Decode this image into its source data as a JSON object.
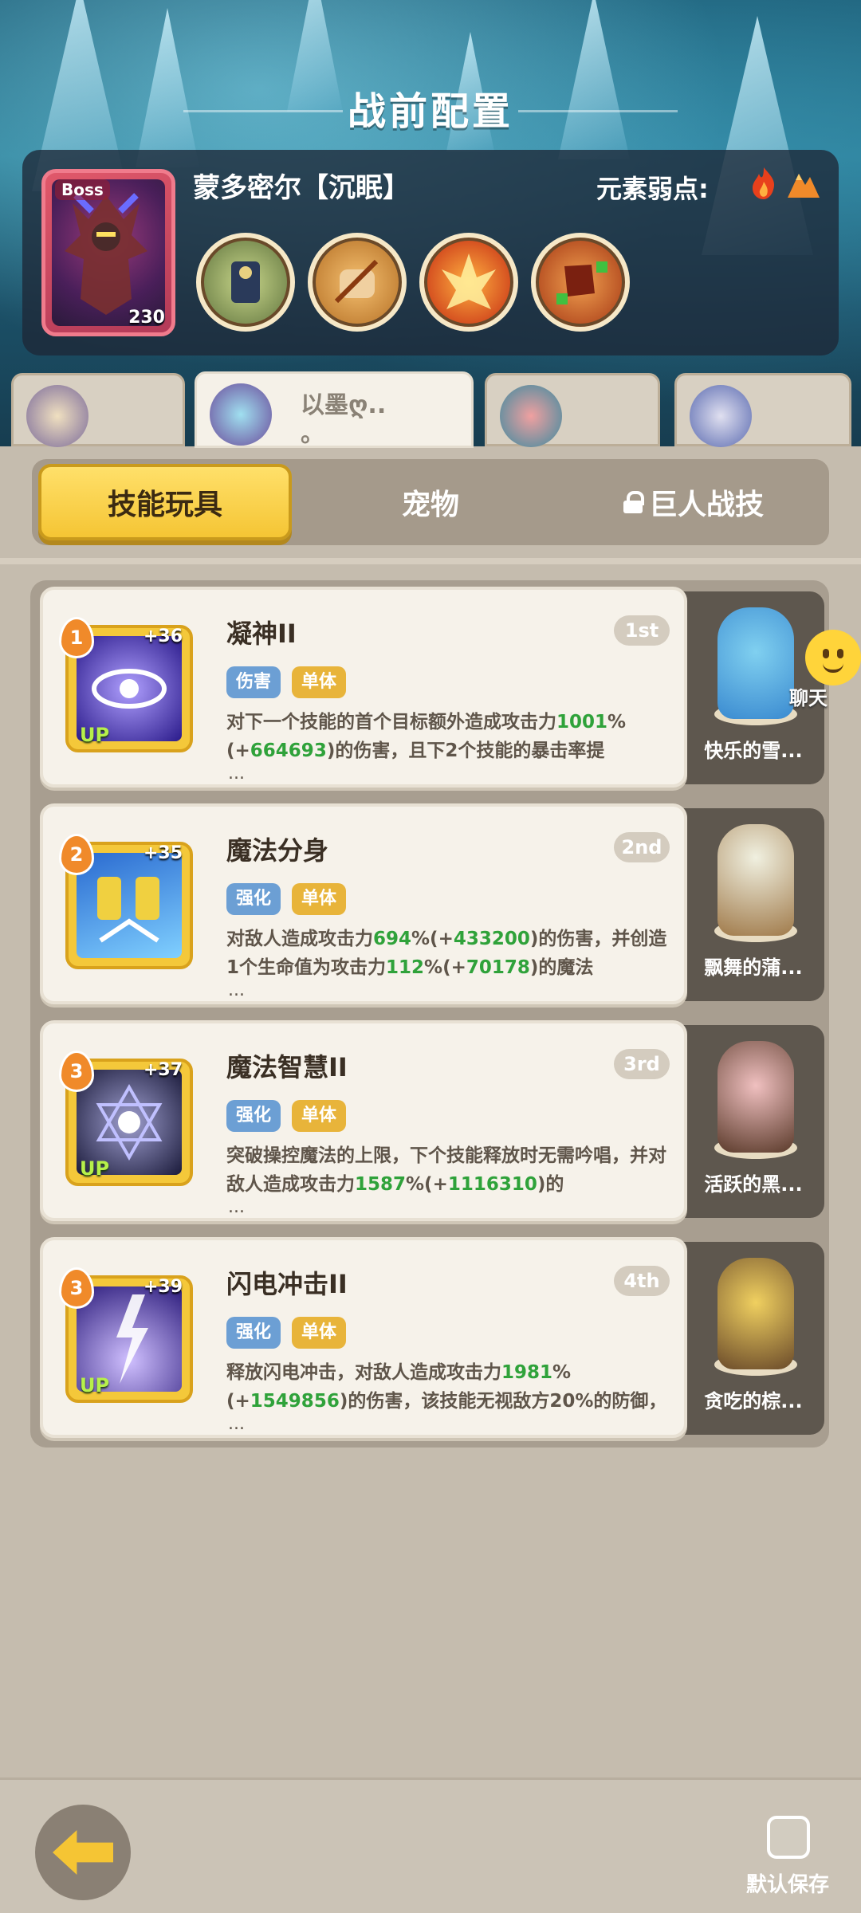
{
  "header": {
    "title": "战前配置"
  },
  "boss": {
    "tag": "Boss",
    "level": "230",
    "name": "蒙多密尔【沉眠】",
    "weakness_label": "元素弱点:",
    "weakness_icons": [
      "fire-element-icon",
      "earth-element-icon"
    ],
    "skill_icons": [
      "boss-skill-1-icon",
      "boss-skill-2-icon",
      "boss-skill-3-icon",
      "boss-skill-4-icon"
    ]
  },
  "heroes": [
    {
      "name": "",
      "active": false
    },
    {
      "name": "以墨ღ..",
      "sub": "。",
      "active": true
    },
    {
      "name": "",
      "active": false
    },
    {
      "name": "",
      "active": false
    }
  ],
  "tabs": [
    {
      "label": "技能玩具",
      "active": true
    },
    {
      "label": "宠物",
      "active": false
    },
    {
      "label": "巨人战技",
      "active": false,
      "locked": true
    }
  ],
  "skills": [
    {
      "rank": "1",
      "level_plus": "+36",
      "up": "UP",
      "name": "凝神II",
      "order": "1st",
      "tags": [
        "伤害",
        "单体"
      ],
      "desc_a": "对下一个技能的首个目标额外造成攻击力",
      "desc_b": "1001",
      "desc_c": "%(+",
      "desc_d": "664693",
      "desc_e": ")的伤害，且下2个技能的暴击率提",
      "more": "...",
      "pet": "快乐的雪..."
    },
    {
      "rank": "2",
      "level_plus": "+35",
      "up": "",
      "name": "魔法分身",
      "order": "2nd",
      "tags": [
        "强化",
        "单体"
      ],
      "desc_a": "对敌人造成攻击力",
      "desc_b": "694",
      "desc_c": "%(+",
      "desc_d": "433200",
      "desc_e": ")的伤害，并创造1个生命值为攻击力",
      "desc_f": "112",
      "desc_g": "%(+",
      "desc_h": "70178",
      "desc_i": ")的魔法",
      "more": "...",
      "pet": "飘舞的蒲..."
    },
    {
      "rank": "3",
      "level_plus": "+37",
      "up": "UP",
      "name": "魔法智慧II",
      "order": "3rd",
      "tags": [
        "强化",
        "单体"
      ],
      "desc_a": "突破操控魔法的上限，下个技能释放时无需吟唱，并对敌人造成攻击力",
      "desc_b": "1587",
      "desc_c": "%(+",
      "desc_d": "1116310",
      "desc_e": ")的",
      "more": "...",
      "pet": "活跃的黑..."
    },
    {
      "rank": "3",
      "level_plus": "+39",
      "up": "UP",
      "name": "闪电冲击II",
      "order": "4th",
      "tags": [
        "强化",
        "单体"
      ],
      "desc_a": "释放闪电冲击，对敌人造成攻击力",
      "desc_b": "1981",
      "desc_c": "%(+",
      "desc_d": "1549856",
      "desc_e": ")的伤害，该技能无视敌方20%的防御，",
      "more": "...",
      "pet": "贪吃的棕..."
    }
  ],
  "chat": {
    "label": "聊天"
  },
  "footer": {
    "save_label": "默认保存"
  }
}
